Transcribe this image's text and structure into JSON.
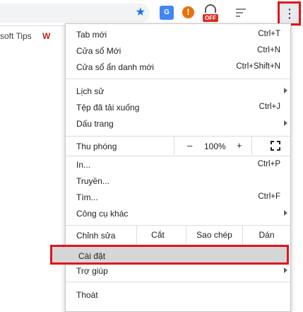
{
  "toolbar": {
    "bookmark_icon": "star-icon",
    "ext_translate_glyph": "G",
    "ext_warn_glyph": "!",
    "ext_off_badge": "OFF",
    "menu_icon": "more-vert-icon"
  },
  "bookmarks": {
    "item_label": "soft Tips"
  },
  "menu": {
    "new_tab": {
      "label": "Tab mới",
      "shortcut": "Ctrl+T"
    },
    "new_window": {
      "label": "Cửa sổ Mới",
      "shortcut": "Ctrl+N"
    },
    "incognito": {
      "label": "Cửa sổ ẩn danh mới",
      "shortcut": "Ctrl+Shift+N"
    },
    "history": {
      "label": "Lịch sử"
    },
    "downloads": {
      "label": "Tệp đã tải xuống",
      "shortcut": "Ctrl+J"
    },
    "bookmarks": {
      "label": "Dấu trang"
    },
    "zoom": {
      "label": "Thu phóng",
      "minus": "–",
      "value": "100%",
      "plus": "+"
    },
    "print": {
      "label": "In...",
      "shortcut": "Ctrl+P"
    },
    "cast": {
      "label": "Truyền..."
    },
    "find": {
      "label": "Tìm...",
      "shortcut": "Ctrl+F"
    },
    "more_tools": {
      "label": "Công cụ khác"
    },
    "edit": {
      "label": "Chỉnh sửa",
      "cut": "Cắt",
      "copy": "Sao chép",
      "paste": "Dán"
    },
    "settings": {
      "label": "Cài đặt"
    },
    "help": {
      "label": "Trợ giúp"
    },
    "exit": {
      "label": "Thoát"
    }
  },
  "colors": {
    "highlight_border": "#e3141c",
    "accent": "#1a73e8"
  }
}
